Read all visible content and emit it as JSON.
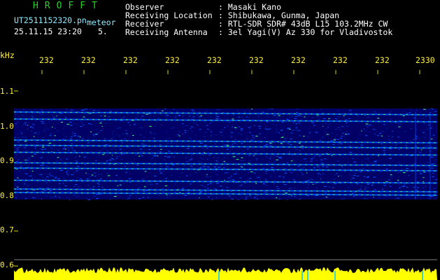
{
  "header": {
    "title": "HROFFT",
    "filename": "UT2511152320.pn",
    "tag": "meteor",
    "datetime": "25.11.15 23:20",
    "count": "5.",
    "labels": {
      "observer": "Observer",
      "location": "Receiving Location",
      "receiver": "Receiver",
      "antenna": "Receiving Antenna"
    },
    "values": {
      "observer": ": Masaki Kano",
      "location": ": Shibukawa, Gunma, Japan",
      "receiver": ": RTL-SDR SDR# 43dB L15 103.2MHz CW",
      "antenna": ": 3el Yagi(V) Az 330 for Vladivostok"
    }
  },
  "axis": {
    "unit": "kHz",
    "time_ticks": [
      "232",
      "232",
      "232",
      "232",
      "232",
      "232",
      "232",
      "232",
      "232",
      "2330"
    ],
    "freq_ticks": [
      "1.1",
      "1.0",
      "0.9",
      "0.8",
      "0.7",
      "0.6"
    ]
  },
  "colors": {
    "background": "#000000",
    "spectrum_low": "#000066",
    "spectrum_mid": "#0050ff",
    "spectrum_high": "#40ff80",
    "grid": "#d6d600",
    "noise_bar": "#ffff00",
    "marker": "#00c8ff"
  },
  "spectrogram": {
    "band_top_khz": 1.05,
    "band_bottom_khz": 0.79,
    "strong_lines_khz": [
      1.04,
      1.02,
      0.96,
      0.945,
      0.925,
      0.895,
      0.88,
      0.845,
      0.82,
      0.81
    ]
  }
}
